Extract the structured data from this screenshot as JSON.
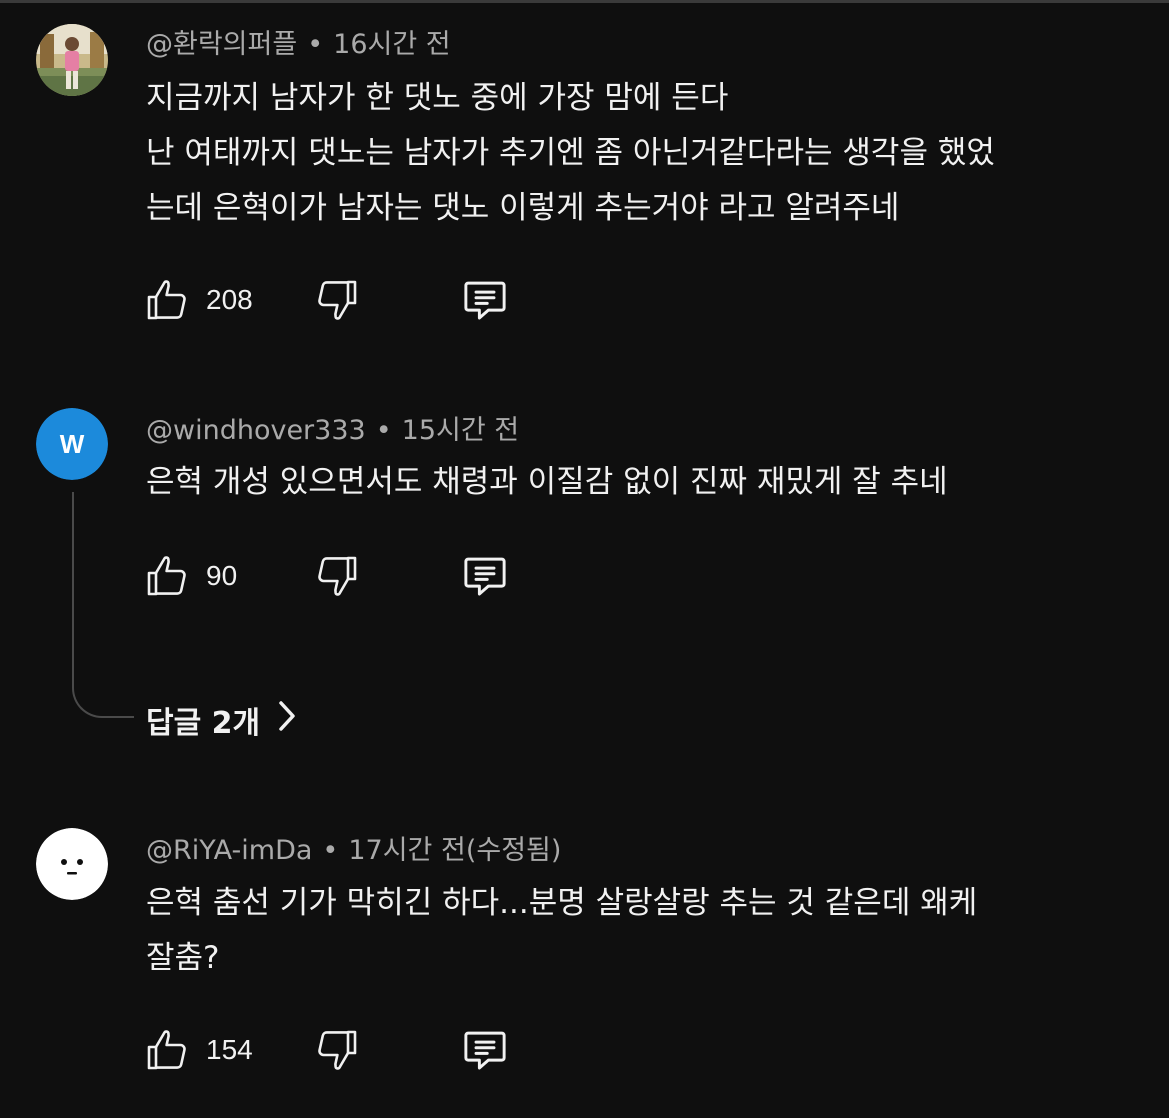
{
  "colors": {
    "background": "#0f0f0f",
    "text": "#f1f1f1",
    "meta": "#aaaaaa",
    "avatar_w_bg": "#1c8adb"
  },
  "comments": [
    {
      "author": "@환락의퍼플",
      "time": "16시간 전",
      "avatar": "photo-avatar",
      "lines": [
        "지금까지 남자가 한 댓노 중에 가장 맘에 든다",
        "난 여태까지 댓노는 남자가 추기엔 좀 아닌거같다라는 생각을 했었",
        "는데 은혁이가 남자는 댓노 이렇게 추는거야 라고 알려주네"
      ],
      "likes": "208"
    },
    {
      "author": "@windhover333",
      "time": "15시간 전",
      "avatar": "letter-avatar",
      "avatar_letter": "W",
      "lines": [
        "은혁 개성 있으면서도 채령과 이질감 없이 진짜 재밌게 잘 추네"
      ],
      "likes": "90",
      "replies_label": "답글 2개"
    },
    {
      "author": "@RiYA-imDa",
      "time": "17시간 전(수정됨)",
      "avatar": "face-avatar",
      "lines": [
        "은혁 춤선 기가 막히긴 하다...분명 살랑살랑 추는 것 같은데 왜케",
        "잘춤?"
      ],
      "likes": "154"
    }
  ],
  "icons": {
    "like": "thumbs-up-icon",
    "dislike": "thumbs-down-icon",
    "reply": "comment-icon",
    "expand": "chevron-right-icon"
  }
}
